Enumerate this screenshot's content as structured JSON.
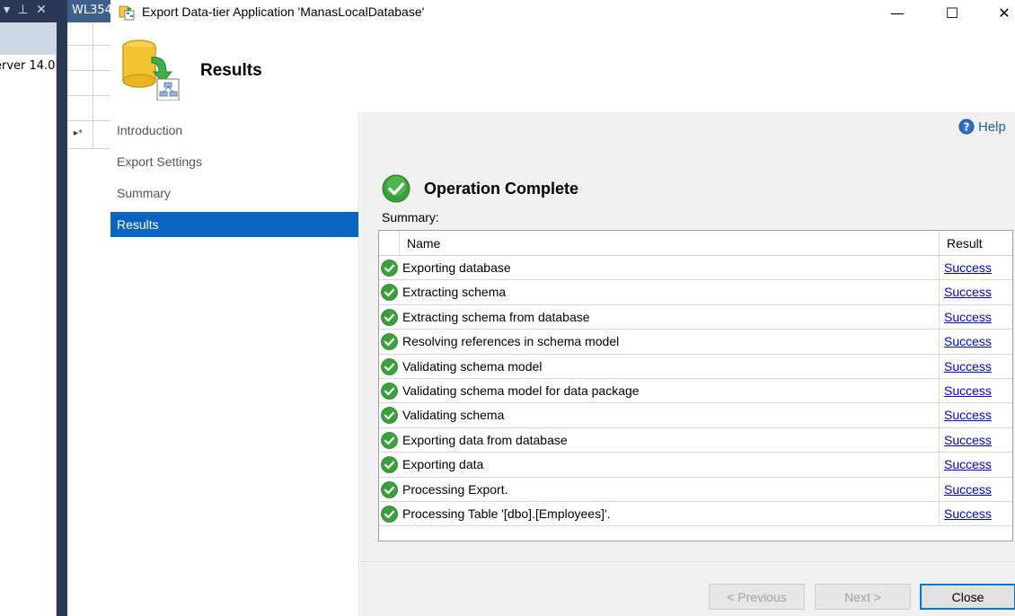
{
  "background": {
    "left_panel_tools": "▾ ⊥ ✕",
    "left_panel_text": "erver 14.0",
    "tab_label": "WL354",
    "row_marker": "▸*"
  },
  "window": {
    "title": "Export Data-tier Application 'ManasLocalDatabase'",
    "minimize": "—",
    "maximize": "☐",
    "close": "✕"
  },
  "header": {
    "title": "Results",
    "icon": "database-export-icon"
  },
  "nav": {
    "items": [
      {
        "label": "Introduction",
        "active": false
      },
      {
        "label": "Export Settings",
        "active": false
      },
      {
        "label": "Summary",
        "active": false
      },
      {
        "label": "Results",
        "active": true
      }
    ]
  },
  "content": {
    "help_label": "Help",
    "status_title": "Operation Complete",
    "summary_label": "Summary:",
    "table": {
      "columns": [
        "Name",
        "Result"
      ],
      "rows": [
        {
          "name": "Exporting database",
          "result": "Success"
        },
        {
          "name": "Extracting schema",
          "result": "Success"
        },
        {
          "name": "Extracting schema from database",
          "result": "Success"
        },
        {
          "name": "Resolving references in schema model",
          "result": "Success"
        },
        {
          "name": "Validating schema model",
          "result": "Success"
        },
        {
          "name": "Validating schema model for data package",
          "result": "Success"
        },
        {
          "name": "Validating schema",
          "result": "Success"
        },
        {
          "name": "Exporting data from database",
          "result": "Success"
        },
        {
          "name": "Exporting data",
          "result": "Success"
        },
        {
          "name": "Processing Export.",
          "result": "Success"
        },
        {
          "name": "Processing Table '[dbo].[Employees]'.",
          "result": "Success"
        }
      ]
    }
  },
  "footer": {
    "previous_label": "< Previous",
    "next_label": "Next >",
    "close_label": "Close"
  },
  "colors": {
    "nav_active": "#0a64c0",
    "link": "#0000ee",
    "success_green": "#3aa13a",
    "help_blue": "#1d5fab"
  }
}
